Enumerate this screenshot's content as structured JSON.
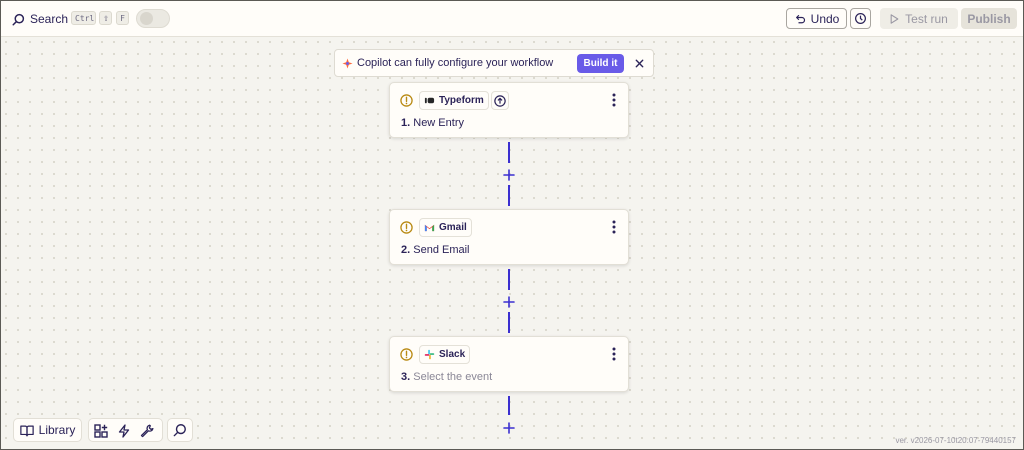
{
  "header": {
    "search_label": "Search",
    "shortcut_keys": [
      "Ctrl",
      "⇧",
      "F"
    ],
    "undo_label": "Undo",
    "test_run_label": "Test run",
    "publish_label": "Publish"
  },
  "copilot_banner": {
    "text": "Copilot can fully configure your workflow",
    "build_label": "Build it"
  },
  "steps": [
    {
      "number": "1.",
      "app": "Typeform",
      "title": "New Entry",
      "title_placeholder": false,
      "icon": "typeform-icon"
    },
    {
      "number": "2.",
      "app": "Gmail",
      "title": "Send Email",
      "title_placeholder": false,
      "icon": "gmail-icon"
    },
    {
      "number": "3.",
      "app": "Slack",
      "title": "Select the event",
      "title_placeholder": true,
      "icon": "slack-icon"
    }
  ],
  "bottom_toolbar": {
    "library_label": "Library",
    "tools": [
      "add-apps-icon",
      "lightning-icon",
      "wrench-icon",
      "search-icon"
    ]
  },
  "version": "ver. v2026-07-10t20:07-79440157",
  "colors": {
    "accent": "#695be8",
    "connector": "#3b2fd0",
    "warning": "#b98a14",
    "text": "#2b2358",
    "canvas": "#f5f4ef"
  }
}
